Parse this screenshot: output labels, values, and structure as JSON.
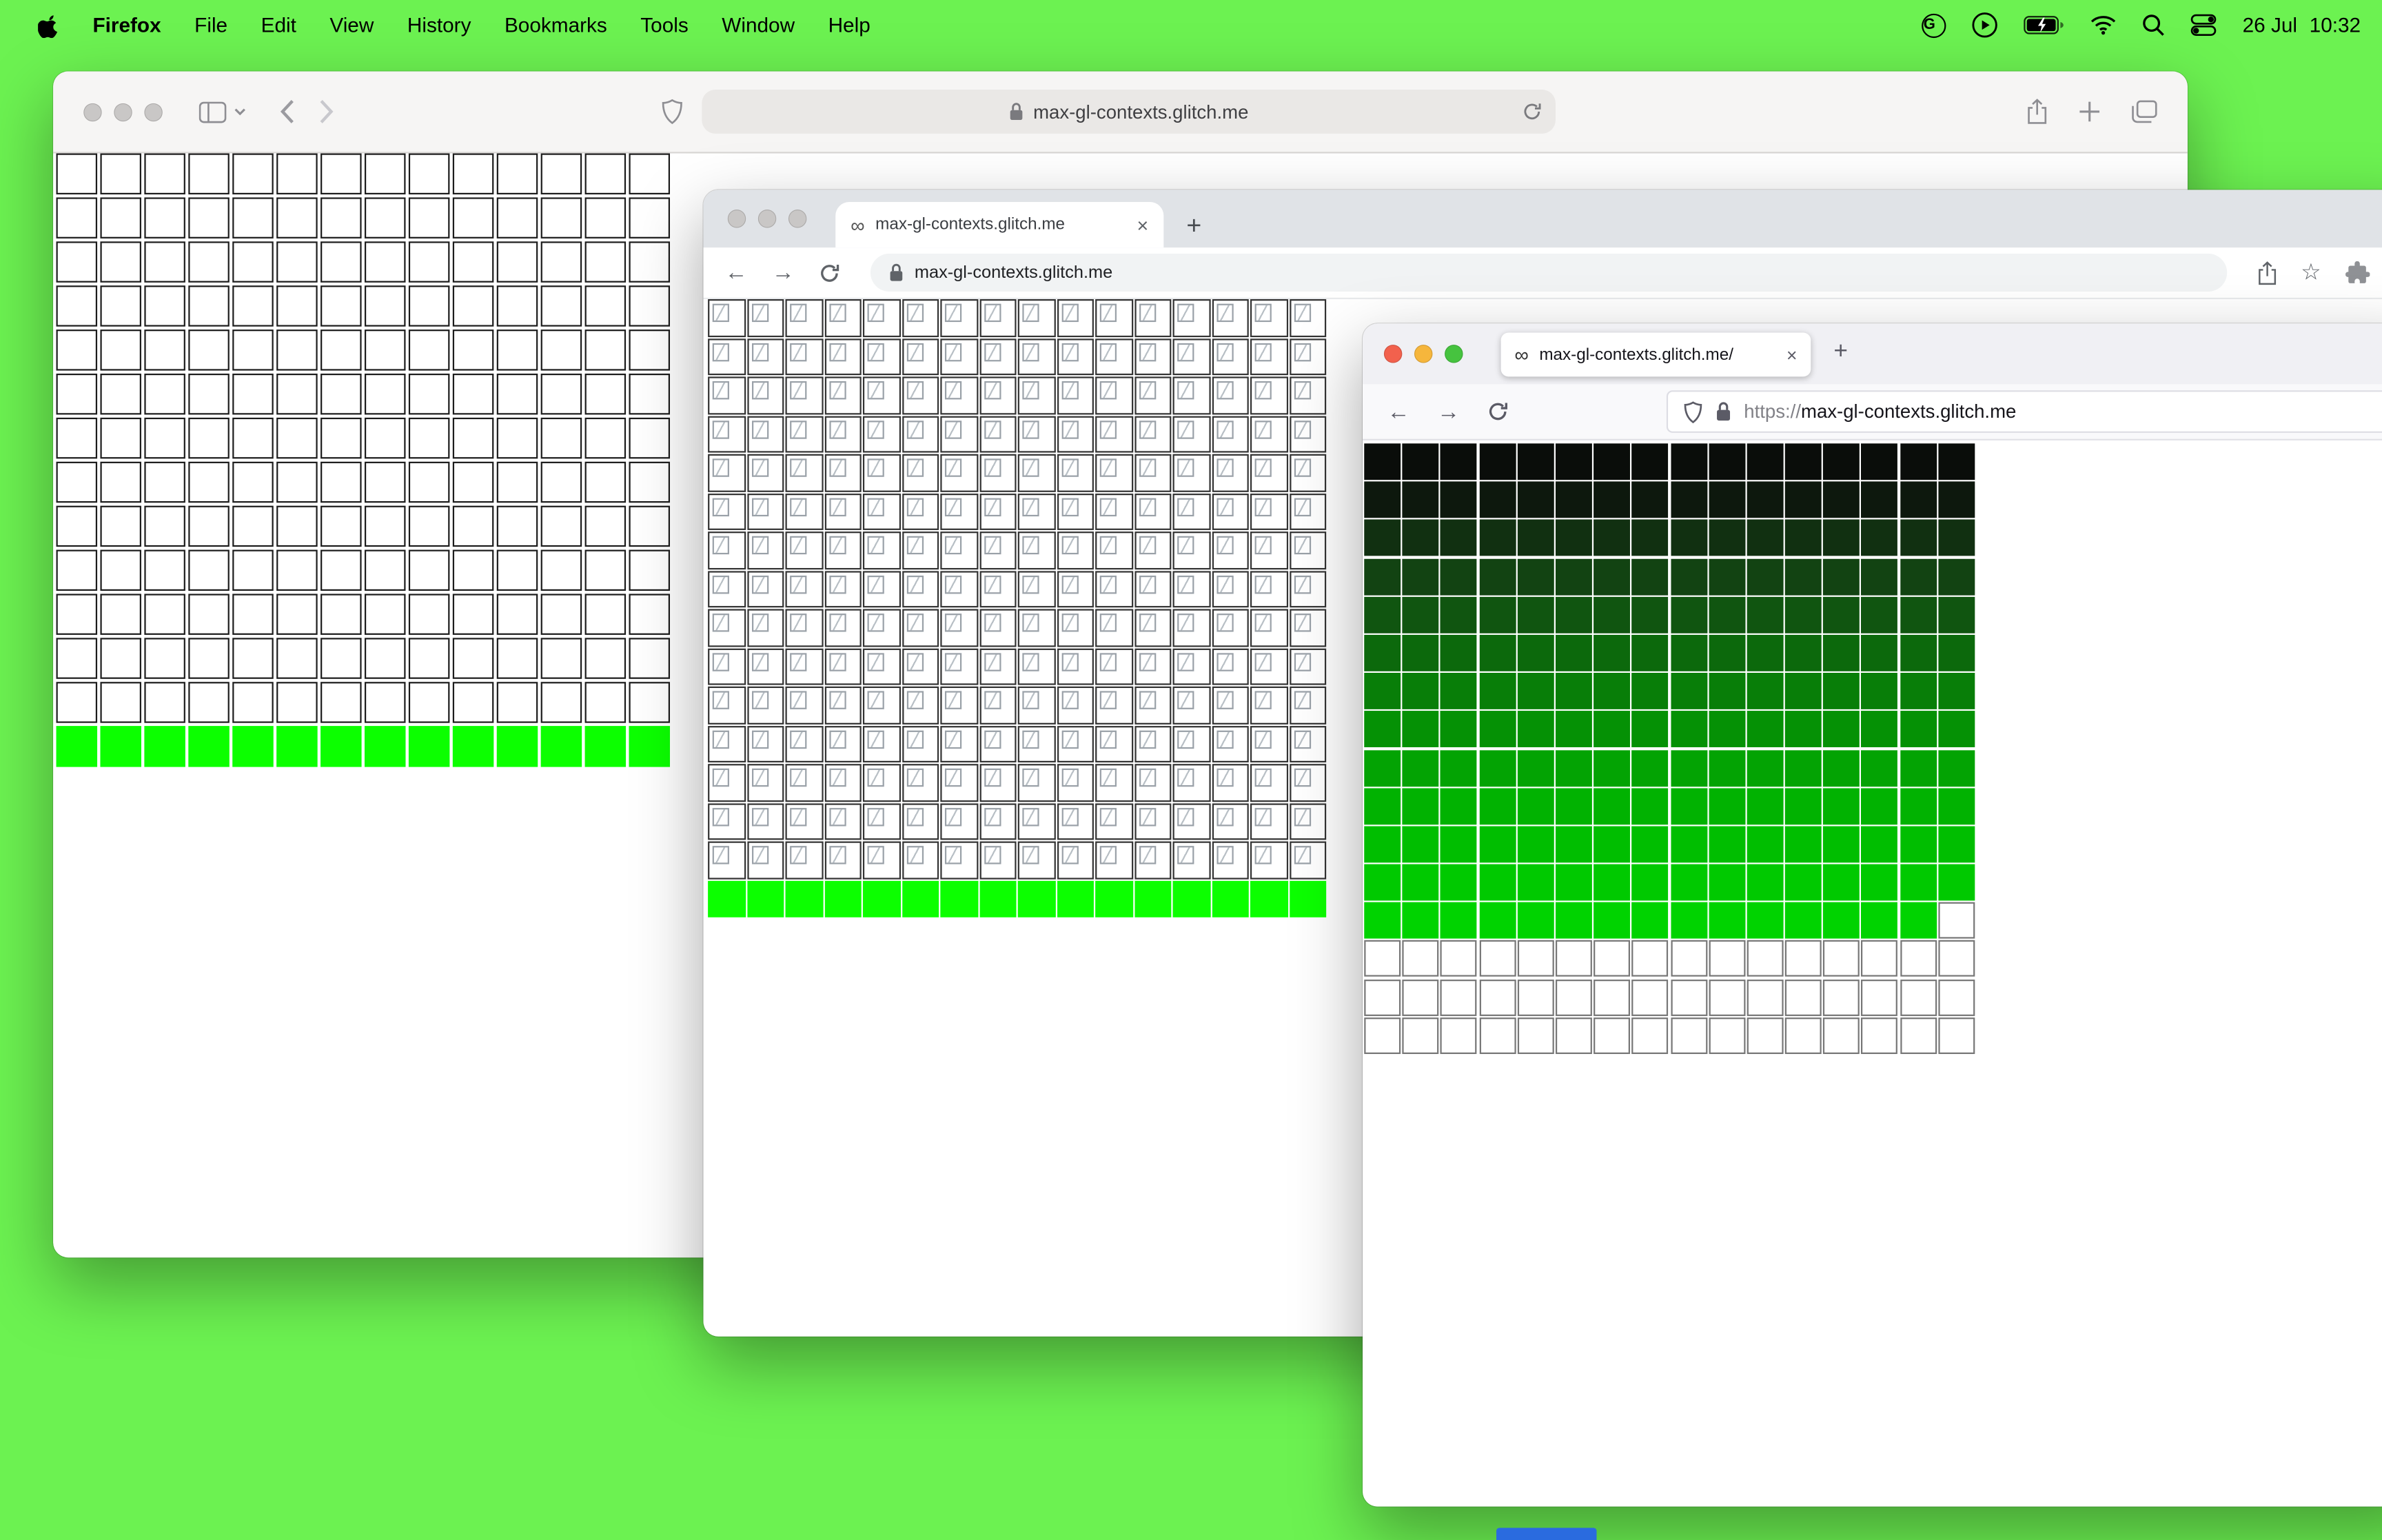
{
  "desktop": {
    "background": "#6cf251",
    "live_green": "#0cff00",
    "dock_peek_color": "#2a6bdf"
  },
  "menubar": {
    "app": "Firefox",
    "items": [
      "File",
      "Edit",
      "View",
      "History",
      "Bookmarks",
      "Tools",
      "Window",
      "Help"
    ],
    "date": "26 Jul",
    "time": "10:32",
    "g_badge": "G"
  },
  "glyphs": {
    "infinity": "∞",
    "close": "×",
    "plus": "+",
    "back_arrow": "←",
    "forward_arrow": "→",
    "back_chevron": "‹",
    "forward_chevron": "›",
    "star": "☆"
  },
  "safari": {
    "url": "max-gl-contexts.glitch.me",
    "grid": {
      "cols": 14,
      "rows": [
        {
          "repeat": 13,
          "type": "empty"
        },
        {
          "type": "live",
          "color": "#0cff00"
        }
      ]
    }
  },
  "chrome": {
    "tab_title": "max-gl-contexts.glitch.me",
    "url": "max-gl-contexts.glitch.me",
    "grid": {
      "cols": 16,
      "rows": [
        {
          "repeat": 15,
          "type": "broken"
        },
        {
          "type": "live",
          "color": "#0cff00"
        }
      ]
    }
  },
  "firefox": {
    "tab_title": "max-gl-contexts.glitch.me/",
    "url_scheme": "https://",
    "url_host": "max-gl-contexts.glitch.me",
    "grid": {
      "cols": 16,
      "rows": [
        {
          "type": "shade",
          "color": "#0a0d0a"
        },
        {
          "type": "shade",
          "color": "#0d180d"
        },
        {
          "type": "shade",
          "color": "#113011"
        },
        {
          "type": "shade",
          "color": "#124312"
        },
        {
          "type": "shade",
          "color": "#105510"
        },
        {
          "type": "shade",
          "color": "#0c690c"
        },
        {
          "type": "shade",
          "color": "#087e08"
        },
        {
          "type": "shade",
          "color": "#059105"
        },
        {
          "type": "shade",
          "color": "#03a303"
        },
        {
          "type": "shade",
          "color": "#01b201"
        },
        {
          "type": "shade",
          "color": "#00be00"
        },
        {
          "type": "shade",
          "color": "#00c900"
        },
        {
          "type": "shade",
          "color": "#00d300",
          "last_cell": "empty"
        },
        {
          "repeat": 3,
          "type": "empty"
        }
      ]
    }
  }
}
